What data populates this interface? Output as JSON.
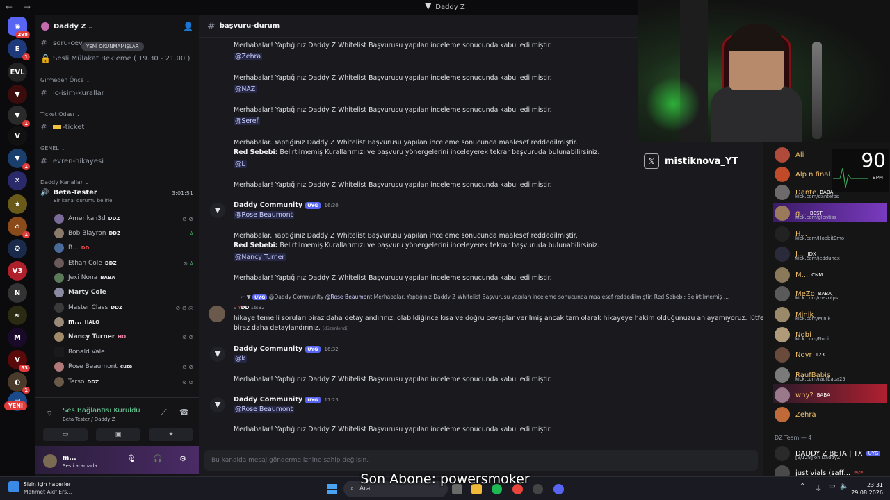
{
  "window": {
    "title": "Daddy Z",
    "nav": "← →"
  },
  "guilds": {
    "new_label": "YENİ",
    "badges": [
      "298",
      "1",
      "1",
      "1",
      "1",
      "1",
      "1",
      "33",
      "1"
    ]
  },
  "server": {
    "name": "Daddy Z",
    "unread_pill": "YENİ OKUNMAMIŞLAR"
  },
  "channels": {
    "top": [
      {
        "name": "soru-cev"
      },
      {
        "name": "Sesli Mülakat Bekleme ( 19.30 - 21.00 )"
      }
    ],
    "categories": [
      {
        "name": "Girmeden Önce",
        "channels": [
          "ic-isim-kurallar"
        ]
      },
      {
        "name": "Ticket Odası",
        "channels": [
          "-ticket"
        ]
      },
      {
        "name": "GENEL",
        "channels": [
          "evren-hikayesi"
        ]
      },
      {
        "name": "Daddy Kanallar",
        "channels": []
      }
    ],
    "voice": {
      "name": "Beta-Tester",
      "time": "3:01:51",
      "status": "Bir kanal durumu belirle",
      "members": [
        {
          "name": "Amerikalı3d",
          "tag": "DDZ"
        },
        {
          "name": "Bob Blayron",
          "tag": "DDZ"
        },
        {
          "name": "B...",
          "tag": "DD"
        },
        {
          "name": "Ethan Cole",
          "tag": "DDZ"
        },
        {
          "name": "Jexi Nona",
          "tag": "BABA"
        },
        {
          "name": "Marty Cole",
          "tag": ""
        },
        {
          "name": "Master Class",
          "tag": "DDZ"
        },
        {
          "name": "m...",
          "tag": "HALO"
        },
        {
          "name": "Nancy Turner",
          "tag": "HO"
        },
        {
          "name": "Ronald Vale",
          "tag": ""
        },
        {
          "name": "Rose Beaumont",
          "tag": "cute"
        },
        {
          "name": "Terso",
          "tag": "DDZ"
        }
      ]
    }
  },
  "voice_connection": {
    "status": "Ses Bağlantısı Kuruldu",
    "path": "Beta-Tester / Daddy Z"
  },
  "user_panel": {
    "name": "m...",
    "status": "Sesli aramada"
  },
  "chat": {
    "channel": "başvuru-durum",
    "accept_msg": "Merhabalar! Yaptığınız Daddy Z Whitelist Başvurusu yapılan inceleme sonucunda kabul edilmiştir.",
    "reject_msg": "Merhabalar. Yaptığınız Daddy Z Whitelist Başvurusu yapılan inceleme sonucunda maalesef reddedilmiştir.",
    "reason_label": "Red Sebebi:",
    "reason_text": " Belirtilmemiş Kurallarımızı ve başvuru yönergelerini inceleyerek tekrar başvuruda bulunabilirsiniz.",
    "mentions": [
      "@Zehra",
      "@NAZ",
      "@Seref",
      "@L",
      "@Rose Beaumont",
      "@Nancy Turner",
      "@k",
      "@Rose Beaumont"
    ],
    "author": "Daddy Community",
    "author_badge": "UYG",
    "times": [
      "16:30",
      "16:32",
      "17:23"
    ],
    "reply_preview": {
      "badge": "UYG",
      "author": "@Daddy Community",
      "mention": "@Rose Beaumont",
      "text": "Merhabalar. Yaptığınız Daddy Z Whitelist Başvurusu yapılan inceleme sonucunda maalesef reddedilmiştir. Red Sebebi: Belirtilmemiş ..."
    },
    "user_reply": {
      "name": "v",
      "tag": "DD",
      "time": "16:32",
      "line1": "hikaye temelli soruları biraz daha detaylandırınız, olabildiğince kısa ve doğru cevaplar verilmiş ancak tam olarak hikayeye hakim olduğunuzu anlayamıyoruz. lütfen",
      "line2": "biraz daha detaylandırınız.",
      "edited": "(düzenlendi)"
    },
    "input_placeholder": "Bu kanalda mesaj gönderme iznine sahip değilsin."
  },
  "stream": {
    "social": "mistiknova_YT",
    "bpm": "90",
    "bpm_label": "BPM",
    "viewers": [
      {
        "name": "Ali",
        "tag": "",
        "sub": ""
      },
      {
        "name": "Alp n final",
        "tag": "",
        "sub": ""
      },
      {
        "name": "Dante",
        "tag": "BABA",
        "sub": "kick.com/dantefps"
      },
      {
        "name": "g...",
        "tag": "BEST",
        "sub": "kick.com/glentiss"
      },
      {
        "name": "H...",
        "tag": "",
        "sub": "kick.com/HobbitEmo"
      },
      {
        "name": "J...",
        "tag": "JDX",
        "sub": "kick.com/jeddunex"
      },
      {
        "name": "M...",
        "tag": "CNM",
        "sub": ""
      },
      {
        "name": "MeZo",
        "tag": "BABA",
        "sub": "kick.com/mezofps"
      },
      {
        "name": "Minik",
        "tag": "",
        "sub": "kick.com/Minik"
      },
      {
        "name": "Nobi",
        "tag": "",
        "sub": "kick.com/Nobi"
      },
      {
        "name": "Noyr",
        "tag": "123",
        "sub": ""
      },
      {
        "name": "RaufBabiş",
        "tag": "",
        "sub": "kick.com/raufbaba25"
      },
      {
        "name": "why?",
        "tag": "BABA",
        "sub": ""
      },
      {
        "name": "Zehra",
        "tag": "",
        "sub": ""
      }
    ],
    "team_header": "DZ Team — 4",
    "team": [
      {
        "name": "DADDY Z BETA | TX",
        "tag": "UYG",
        "sub": "[9/128] on DaddyZ"
      },
      {
        "name": "just vials (saff...",
        "tag": "PVP",
        "sub": ""
      }
    ]
  },
  "overlay_subtitle": "Son Abone: powersmoker",
  "taskbar": {
    "news_title": "Sizin için haberler",
    "news_sub": "Mehmet Akif Ers...",
    "search": "Ara",
    "time": "23:31",
    "date": "29.08.2026"
  }
}
